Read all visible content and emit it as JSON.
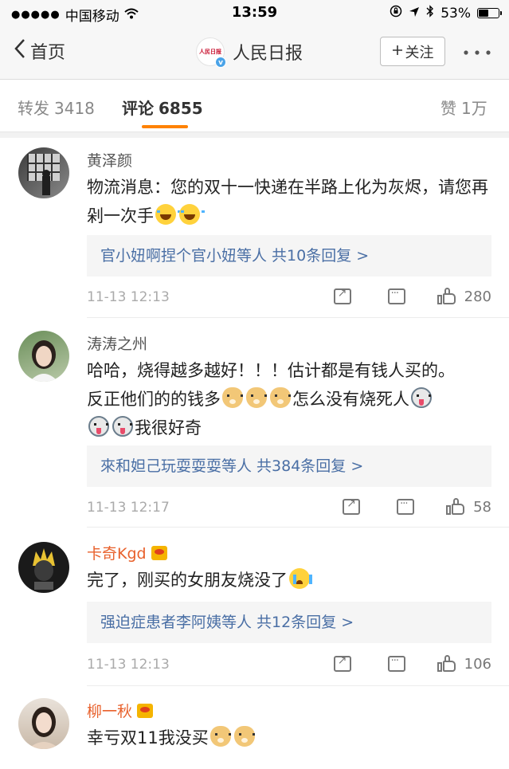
{
  "status_bar": {
    "signal": "●●●●●",
    "carrier": "中国移动",
    "wifi_icon": "wifi-icon",
    "time": "13:59",
    "battery_percent": "53%",
    "battery_level": 0.53
  },
  "nav": {
    "back_label": "首页",
    "title": "人民日报",
    "follow_label": "关注",
    "logo_text": "人民日报",
    "verified_badge": "v"
  },
  "tabs": {
    "repost": {
      "label": "转发",
      "count": "3418"
    },
    "comments": {
      "label": "评论",
      "count": "6855"
    },
    "likes": {
      "label": "赞",
      "count": "1万"
    }
  },
  "comments": [
    {
      "user": "黄泽颜",
      "vip": false,
      "text_before": "物流消息：您的双十一快递在半路上化为灰烬，请您再剁一次手",
      "reply_names": "官小妞啊捏个官小妞等人",
      "reply_count": "共10条回复 >",
      "time": "11-13 12:13",
      "likes": "280"
    },
    {
      "user": "涛涛之州",
      "vip": false,
      "text_line1": "哈哈，烧得越多越好！！！估计都是有钱人买的。",
      "text_line2a": "反正他们的的钱多",
      "text_line2b": "怎么没有烧死人",
      "text_line3": "我很好奇",
      "reply_names": "來和妲己玩耍耍耍等人",
      "reply_count": "共384条回复 >",
      "time": "11-13 12:17",
      "likes": "58"
    },
    {
      "user": "卡奇Kgd",
      "vip": true,
      "text_before": "完了，刚买的女朋友烧没了",
      "reply_names": "强迫症患者李阿姨等人",
      "reply_count": "共12条回复 >",
      "time": "11-13 12:13",
      "likes": "106"
    },
    {
      "user": "柳一秋",
      "vip": true,
      "text_before": "幸亏双11我没买"
    }
  ],
  "colors": {
    "accent": "#ff8200",
    "link": "#4a6fa5",
    "vip_name": "#e8612c"
  }
}
